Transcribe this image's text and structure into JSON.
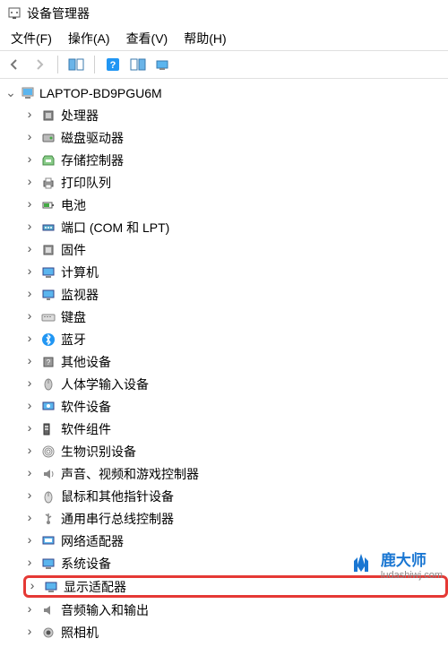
{
  "window": {
    "title": "设备管理器"
  },
  "menu": {
    "file": "文件(F)",
    "action": "操作(A)",
    "view": "查看(V)",
    "help": "帮助(H)"
  },
  "tree": {
    "root": "LAPTOP-BD9PGU6M",
    "items": [
      {
        "label": "处理器",
        "icon": "cpu"
      },
      {
        "label": "磁盘驱动器",
        "icon": "disk"
      },
      {
        "label": "存储控制器",
        "icon": "storage"
      },
      {
        "label": "打印队列",
        "icon": "printer"
      },
      {
        "label": "电池",
        "icon": "battery"
      },
      {
        "label": "端口 (COM 和 LPT)",
        "icon": "port"
      },
      {
        "label": "固件",
        "icon": "firmware"
      },
      {
        "label": "计算机",
        "icon": "computer"
      },
      {
        "label": "监视器",
        "icon": "monitor"
      },
      {
        "label": "键盘",
        "icon": "keyboard"
      },
      {
        "label": "蓝牙",
        "icon": "bluetooth"
      },
      {
        "label": "其他设备",
        "icon": "other"
      },
      {
        "label": "人体学输入设备",
        "icon": "hid"
      },
      {
        "label": "软件设备",
        "icon": "software"
      },
      {
        "label": "软件组件",
        "icon": "component"
      },
      {
        "label": "生物识别设备",
        "icon": "biometric"
      },
      {
        "label": "声音、视频和游戏控制器",
        "icon": "sound"
      },
      {
        "label": "鼠标和其他指针设备",
        "icon": "mouse"
      },
      {
        "label": "通用串行总线控制器",
        "icon": "usb"
      },
      {
        "label": "网络适配器",
        "icon": "network"
      },
      {
        "label": "系统设备",
        "icon": "system"
      },
      {
        "label": "显示适配器",
        "icon": "display",
        "highlighted": true
      },
      {
        "label": "音频输入和输出",
        "icon": "audio"
      },
      {
        "label": "照相机",
        "icon": "camera"
      }
    ]
  },
  "watermark": {
    "brand": "鹿大师",
    "url": "ludashiwj.com"
  }
}
